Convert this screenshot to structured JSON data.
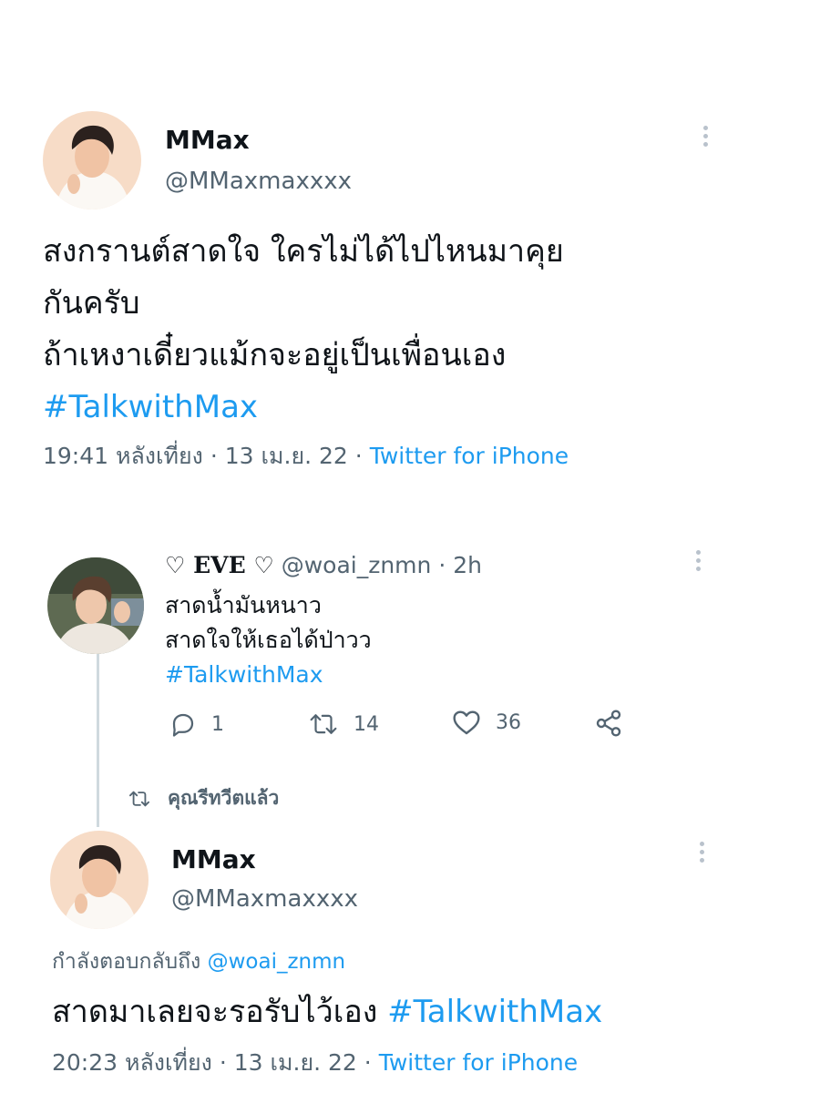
{
  "main_tweet": {
    "author": {
      "display_name": "MMax",
      "handle": "@MMaxmaxxxx"
    },
    "text_lines": [
      "สงกรานต์สาดใจ ใครไม่ได้ไปไหนมาคุย",
      "กันครับ",
      "ถ้าเหงาเดี๋ยวแม้กจะอยู่เป็นเพื่อนเอง"
    ],
    "hashtag": "#TalkwithMax",
    "meta": {
      "time": "19:41 หลังเที่ยง",
      "sep1": "·",
      "date": "13 เม.ย. 22",
      "sep2": "·",
      "source": "Twitter for iPhone"
    }
  },
  "reply_tweet": {
    "author": {
      "display_name": "♡ EVE ♡",
      "handle": "@woai_znmn",
      "time_sep": "·",
      "time": "2h"
    },
    "text_lines": [
      "สาดน้ำมันหนาว",
      "สาดใจให้เธอได้ป่าวว"
    ],
    "hashtag": "#TalkwithMax",
    "actions": {
      "replies": "1",
      "retweets": "14",
      "likes": "36"
    }
  },
  "retweet_banner": {
    "label": "คุณรีทวีตแล้ว"
  },
  "response_tweet": {
    "author": {
      "display_name": "MMax",
      "handle": "@MMaxmaxxxx"
    },
    "replying_to": {
      "prefix": "กำลังตอบกลับถึง",
      "handle": "@woai_znmn"
    },
    "text": "สาดมาเลยจะรอรับไว้เอง",
    "hashtag": "#TalkwithMax",
    "meta": {
      "time": "20:23 หลังเที่ยง",
      "sep1": "·",
      "date": "13 เม.ย. 22",
      "sep2": "·",
      "source": "Twitter for iPhone"
    }
  },
  "colors": {
    "link": "#1d9bf0",
    "secondary": "#536471",
    "primary": "#0f1419",
    "thread_line": "#cfd9de"
  },
  "icons": [
    "more-vertical-icon",
    "reply-icon",
    "retweet-icon",
    "like-icon",
    "share-icon",
    "retweet-small-icon"
  ]
}
